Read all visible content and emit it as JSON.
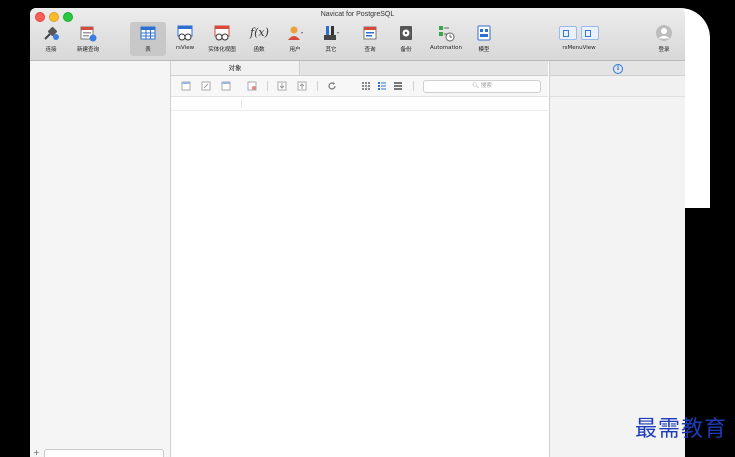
{
  "window": {
    "title": "Navicat for PostgreSQL"
  },
  "toolbar": {
    "items": [
      {
        "label": "连接",
        "icon": "plug-icon"
      },
      {
        "label": "新建查询",
        "icon": "new-query-icon"
      },
      {
        "label": "表",
        "icon": "table-icon",
        "selected": true
      },
      {
        "label": "rsView",
        "icon": "view-icon"
      },
      {
        "label": "实体化视图",
        "icon": "materialized-view-icon"
      },
      {
        "label": "函数",
        "icon": "function-icon",
        "glyph": "f(x)"
      },
      {
        "label": "用户",
        "icon": "user-icon"
      },
      {
        "label": "其它",
        "icon": "other-icon"
      },
      {
        "label": "查询",
        "icon": "query-icon"
      },
      {
        "label": "备份",
        "icon": "backup-icon"
      },
      {
        "label": "Automation",
        "icon": "automation-icon"
      },
      {
        "label": "模型",
        "icon": "model-icon"
      }
    ],
    "menu_view_label": "rsMenuView",
    "login_label": "登录"
  },
  "center": {
    "tab_label": "对象",
    "search_placeholder": "搜索"
  },
  "right": {
    "info_glyph": "i"
  },
  "watermark": "最需教育",
  "colors": {
    "accent": "#2a7ae2",
    "watermark": "#1d3bb8"
  }
}
